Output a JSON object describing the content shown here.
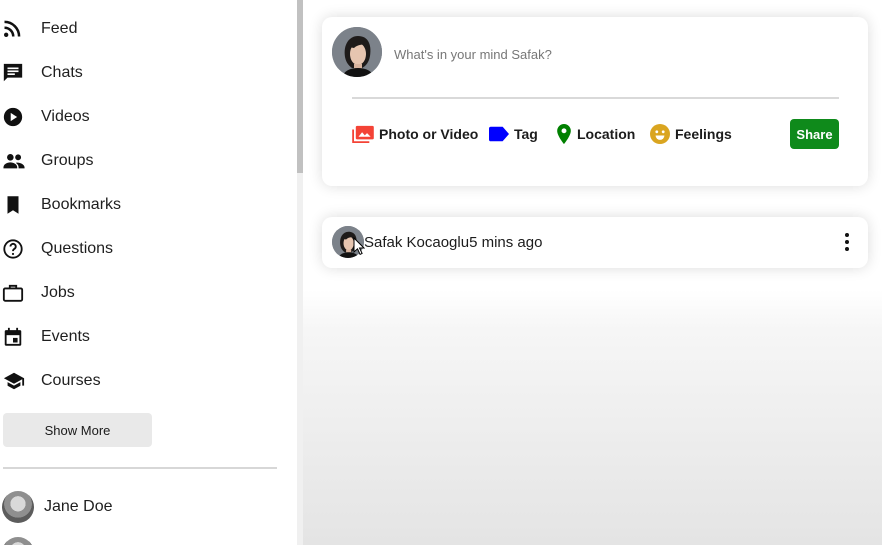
{
  "sidebar": {
    "menu": [
      {
        "label": "Feed",
        "icon": "rss-feed-icon"
      },
      {
        "label": "Chats",
        "icon": "chat-icon"
      },
      {
        "label": "Videos",
        "icon": "play-circle-icon"
      },
      {
        "label": "Groups",
        "icon": "group-icon"
      },
      {
        "label": "Bookmarks",
        "icon": "bookmark-icon"
      },
      {
        "label": "Questions",
        "icon": "help-circle-icon"
      },
      {
        "label": "Jobs",
        "icon": "work-outline-icon"
      },
      {
        "label": "Events",
        "icon": "event-icon"
      },
      {
        "label": "Courses",
        "icon": "school-icon"
      }
    ],
    "show_more": "Show More",
    "friends": [
      {
        "name": "Jane Doe"
      }
    ]
  },
  "share": {
    "placeholder": "What's in your mind Safak?",
    "options": [
      {
        "label": "Photo or Video",
        "icon": "perm-media-icon",
        "color": "#f44336"
      },
      {
        "label": "Tag",
        "icon": "label-icon",
        "color": "#0000ff"
      },
      {
        "label": "Location",
        "icon": "room-icon",
        "color": "#008000"
      },
      {
        "label": "Feelings",
        "icon": "emoji-emotions-icon",
        "color": "#daa520"
      }
    ],
    "button": "Share",
    "button_color": "#0f8a1b"
  },
  "post": {
    "username": "Safak Kocaoglu",
    "date": "5 mins ago"
  }
}
